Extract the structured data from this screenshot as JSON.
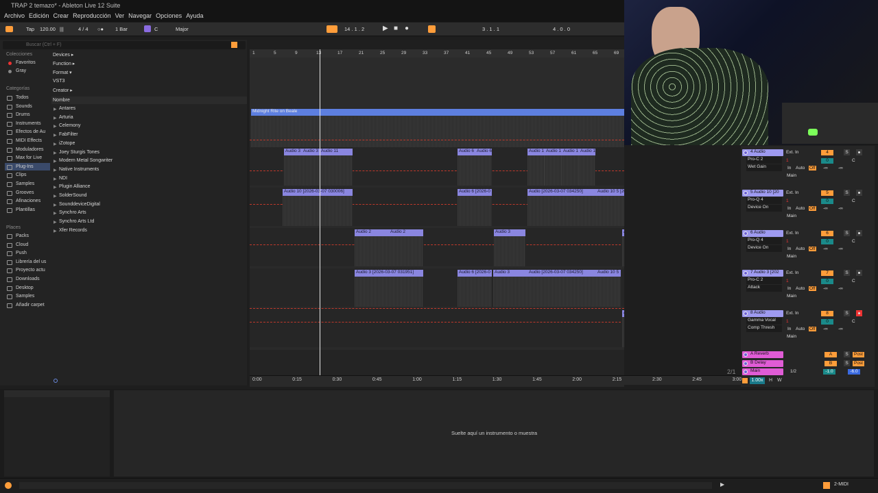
{
  "window_title": "TRAP 2 temazo* - Ableton Live 12 Suite",
  "menu": [
    "Archivo",
    "Edición",
    "Crear",
    "Reproducción",
    "Ver",
    "Navegar",
    "Opciones",
    "Ayuda"
  ],
  "control_bar": {
    "tap": "Tap",
    "tempo": "120.00",
    "time_sig": "4 / 4",
    "quantize": "1 Bar",
    "key": "C",
    "scale": "Major",
    "position": "14 .  1 .  2",
    "loop_start": "3 .  1 .  1",
    "loop_length": "4 .  0 .  0"
  },
  "browser": {
    "search_placeholder": "Buscar (Ctrl + F)",
    "collections_header": "Colecciones",
    "collections": [
      "Favoritos",
      "Gray"
    ],
    "categories_header": "Categorías",
    "categories": [
      "Todos",
      "Sounds",
      "Drums",
      "Instruments",
      "Efectos de Au",
      "MIDI Effects",
      "Moduladores",
      "Max for Live",
      "Plug-Ins",
      "Clips",
      "Samples",
      "Grooves",
      "Afinaciones",
      "Plantillas"
    ],
    "places_header": "Places",
    "places": [
      "Packs",
      "Cloud",
      "Push",
      "Librería del us",
      "Proyecto actu",
      "Downloads",
      "Desktop",
      "Samples",
      "Añadir carpet"
    ],
    "filters": [
      "Devices ▸",
      "Function ▸",
      "Format ▾",
      "VST3",
      "Creator ▸"
    ],
    "name_header": "Nombre",
    "vendors": [
      "Antares",
      "Arturia",
      "Celemony",
      "FabFilter",
      "iZotope",
      "Joey Sturgis Tones",
      "Modern Metal Songwriter",
      "Native Instruments",
      "NDI",
      "Plugin Alliance",
      "SolderSound",
      "SounddeviceDigital",
      "Synchro Arts",
      "Synchro Arts Ltd",
      "Xfer Records"
    ]
  },
  "ruler": [
    "1",
    "5",
    "9",
    "13",
    "17",
    "21",
    "25",
    "29",
    "33",
    "37",
    "41",
    "45",
    "49",
    "53",
    "57",
    "61",
    "65",
    "69"
  ],
  "timeline": [
    "0:00",
    "0:15",
    "0:30",
    "0:45",
    "1:00",
    "1:15",
    "1:30",
    "1:45",
    "2:00",
    "2:15",
    "2:30",
    "2:45",
    "3:00"
  ],
  "main_clip": "Midnight Rite on Beale",
  "clips": {
    "t4": [
      "Audio 3",
      "Audio 3",
      "Audio 11",
      "Audio 6",
      "Audio 6",
      "Audio 1",
      "Audio 1",
      "Audio 1",
      "Audio 1",
      "Audio"
    ],
    "t5": [
      "Audio 10 [2026-03-07 030006]",
      "Audio 6 [2026-0",
      "Audio [2026-03-07 034250]",
      "Audio 10 5 [202",
      "Audio 10 5 [202"
    ],
    "t6": [
      "Audio 2",
      "Audio 2",
      "Audio 3",
      "Au",
      "Audio"
    ],
    "t7": [
      "Audio 3 [2026-03-07 031951]",
      "Audio 6 [2026-0",
      "Audio 3",
      "Audio [2026-03-07 034250]",
      "Audio 10 5"
    ],
    "t8": [
      "Aud"
    ]
  },
  "tracks": [
    {
      "name": "4 Audio",
      "input": "Ext. In",
      "dev1": "Pro-C 2",
      "dev2": "Wet Gain",
      "num": "4",
      "vol": "0",
      "pan": "C",
      "out": "Main"
    },
    {
      "name": "5 Audio 10 [20",
      "input": "Ext. In",
      "dev1": "Pro-Q 4",
      "dev2": "Device On",
      "num": "5",
      "vol": "0",
      "pan": "C",
      "out": "Main"
    },
    {
      "name": "6 Audio",
      "input": "Ext. In",
      "dev1": "Pro-Q 4",
      "dev2": "Device On",
      "num": "6",
      "vol": "0",
      "pan": "C",
      "out": "Main"
    },
    {
      "name": "7 Audio 3 [202",
      "input": "Ext. In",
      "dev1": "Pro-C 2",
      "dev2": "Attack",
      "num": "7",
      "vol": "0",
      "pan": "C",
      "out": "Main"
    },
    {
      "name": "8 Audio",
      "input": "Ext. In",
      "dev1": "Gamma Vocal",
      "dev2": "Comp Thresh",
      "num": "8",
      "vol": "0",
      "pan": "C",
      "out": "Main"
    }
  ],
  "mon": {
    "in": "In",
    "auto": "Auto",
    "off": "Off",
    "inf": "-∞",
    "ch1": "1"
  },
  "returns": [
    {
      "name": "A Reverb",
      "letter": "A",
      "post": "Post"
    },
    {
      "name": "B Delay",
      "letter": "B",
      "post": "Post"
    }
  ],
  "main_track": {
    "name": "Main",
    "sel": "1/2",
    "vol": "-1.0",
    "vol2": "-6.0"
  },
  "zoom": "1.00x",
  "page": "2/1",
  "h_label": "H",
  "w_label": "W",
  "s_label": "S",
  "detail_hint": "Suelte aquí un instrumento o muestra",
  "status_right": "2-MIDI",
  "colors": {
    "accent": "#ff9d3a",
    "clip": "#8a86e0",
    "return": "#e05cd6"
  }
}
